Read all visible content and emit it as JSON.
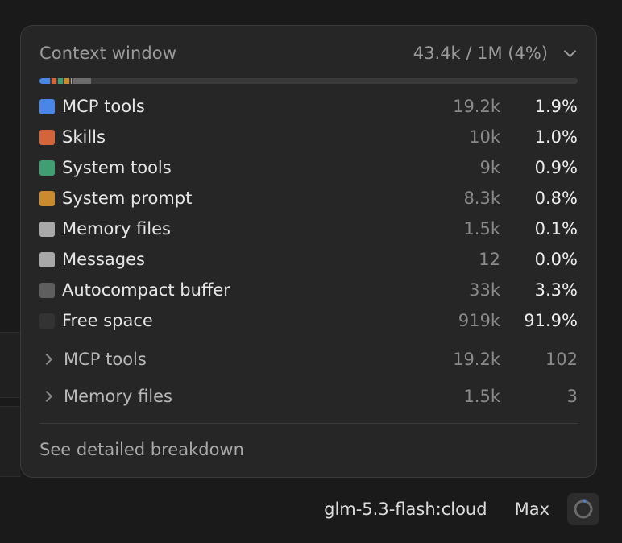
{
  "popover": {
    "title": "Context window",
    "usage": "43.4k / 1M (4%)",
    "bar_segments": [
      {
        "name": "MCP tools",
        "color": "#4a86e8",
        "fraction": 0.0192
      },
      {
        "name": "Skills",
        "color": "#d4643a",
        "fraction": 0.01
      },
      {
        "name": "System tools",
        "color": "#3f9e72",
        "fraction": 0.009
      },
      {
        "name": "System prompt",
        "color": "#c98b2e",
        "fraction": 0.0083
      },
      {
        "name": "Memory files",
        "color": "#a8a8a8",
        "fraction": 0.0015
      },
      {
        "name": "Messages",
        "color": "#a8a8a8",
        "fraction": 0.0
      },
      {
        "name": "Autocompact buffer",
        "color": "#6b6b6b",
        "fraction": 0.033
      }
    ],
    "categories": [
      {
        "label": "MCP tools",
        "value": "19.2k",
        "percent": "1.9%",
        "color": "#4a86e8"
      },
      {
        "label": "Skills",
        "value": "10k",
        "percent": "1.0%",
        "color": "#d4643a"
      },
      {
        "label": "System tools",
        "value": "9k",
        "percent": "0.9%",
        "color": "#3f9e72"
      },
      {
        "label": "System prompt",
        "value": "8.3k",
        "percent": "0.8%",
        "color": "#c98b2e"
      },
      {
        "label": "Memory files",
        "value": "1.5k",
        "percent": "0.1%",
        "color": "#a8a8a8"
      },
      {
        "label": "Messages",
        "value": "12",
        "percent": "0.0%",
        "color": "#a8a8a8"
      },
      {
        "label": "Autocompact buffer",
        "value": "33k",
        "percent": "3.3%",
        "color": "#5e5e5e"
      },
      {
        "label": "Free space",
        "value": "919k",
        "percent": "91.9%",
        "color": "#333333"
      }
    ],
    "expandable": [
      {
        "label": "MCP tools",
        "value": "19.2k",
        "count": "102"
      },
      {
        "label": "Memory files",
        "value": "1.5k",
        "count": "3"
      }
    ],
    "link": "See detailed breakdown"
  },
  "footer": {
    "model": "glm-5.3-flash:cloud",
    "effort": "Max"
  }
}
